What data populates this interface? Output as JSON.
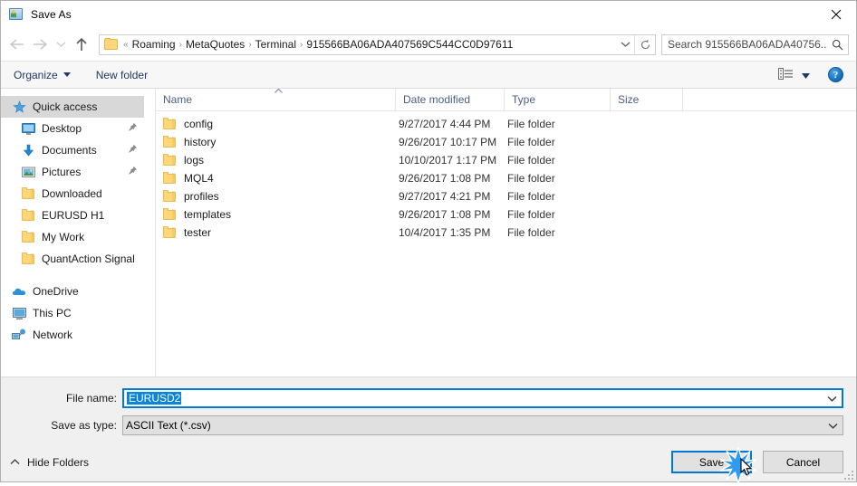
{
  "window": {
    "title": "Save As",
    "title_icon": "save-picture-icon",
    "close_icon": "close-icon"
  },
  "nav": {
    "back_icon": "arrow-left-icon",
    "forward_icon": "arrow-right-icon",
    "recent_icon": "chevron-down-icon",
    "up_icon": "arrow-up-icon",
    "address": {
      "folder_icon": "folder-icon",
      "prefix": "«",
      "crumbs": [
        "Roaming",
        "MetaQuotes",
        "Terminal",
        "915566BA06ADA407569C544CC0D97611"
      ],
      "separator": "›",
      "dropdown_icon": "chevron-down-icon",
      "refresh_icon": "refresh-icon"
    },
    "search": {
      "placeholder": "Search 915566BA06ADA40756...",
      "icon": "search-icon"
    }
  },
  "toolbar": {
    "organize_label": "Organize",
    "organize_caret_icon": "caret-down-icon",
    "new_folder_label": "New folder",
    "view_icon": "view-options-icon",
    "view_caret_icon": "caret-down-icon",
    "help_label": "?",
    "help_icon": "help-icon"
  },
  "sidebar": {
    "items": [
      {
        "label": "Quick access",
        "icon": "star-pin-icon",
        "selected": true,
        "pinned": false,
        "root": true
      },
      {
        "label": "Desktop",
        "icon": "desktop-icon",
        "selected": false,
        "pinned": true,
        "root": false
      },
      {
        "label": "Documents",
        "icon": "documents-download-icon",
        "selected": false,
        "pinned": true,
        "root": false
      },
      {
        "label": "Pictures",
        "icon": "pictures-icon",
        "selected": false,
        "pinned": true,
        "root": false
      },
      {
        "label": "Downloaded",
        "icon": "folder-icon",
        "selected": false,
        "pinned": false,
        "root": false
      },
      {
        "label": "EURUSD H1",
        "icon": "folder-icon",
        "selected": false,
        "pinned": false,
        "root": false
      },
      {
        "label": "My Work",
        "icon": "folder-icon",
        "selected": false,
        "pinned": false,
        "root": false
      },
      {
        "label": "QuantAction Signal",
        "icon": "folder-icon",
        "selected": false,
        "pinned": false,
        "root": false
      }
    ],
    "roots": [
      {
        "label": "OneDrive",
        "icon": "onedrive-cloud-icon"
      },
      {
        "label": "This PC",
        "icon": "this-pc-icon"
      },
      {
        "label": "Network",
        "icon": "network-icon"
      }
    ]
  },
  "filelist": {
    "columns": [
      "Name",
      "Date modified",
      "Type",
      "Size"
    ],
    "sort_column": "Name",
    "sort_icon": "sort-ascending-icon",
    "rows": [
      {
        "name": "config",
        "date": "9/27/2017 4:44 PM",
        "type": "File folder",
        "size": ""
      },
      {
        "name": "history",
        "date": "9/26/2017 10:17 PM",
        "type": "File folder",
        "size": ""
      },
      {
        "name": "logs",
        "date": "10/10/2017 1:17 PM",
        "type": "File folder",
        "size": ""
      },
      {
        "name": "MQL4",
        "date": "9/26/2017 1:08 PM",
        "type": "File folder",
        "size": ""
      },
      {
        "name": "profiles",
        "date": "9/27/2017 4:21 PM",
        "type": "File folder",
        "size": ""
      },
      {
        "name": "templates",
        "date": "9/26/2017 1:08 PM",
        "type": "File folder",
        "size": ""
      },
      {
        "name": "tester",
        "date": "10/4/2017 1:35 PM",
        "type": "File folder",
        "size": ""
      }
    ]
  },
  "form": {
    "filename_label": "File name:",
    "filename_value": "EURUSD2",
    "filename_dropdown_icon": "chevron-down-icon",
    "filetype_label": "Save as type:",
    "filetype_value": "ASCII Text (*.csv)",
    "filetype_dropdown_icon": "chevron-down-icon"
  },
  "footer": {
    "hide_folders_label": "Hide Folders",
    "hide_folders_icon": "chevron-up-icon",
    "save_label": "Save",
    "cancel_label": "Cancel",
    "resize_grip_icon": "resize-grip-icon"
  },
  "colors": {
    "accent": "#0078d7",
    "selection": "#0a84d8",
    "folder": "#ffd77a",
    "toolbar_text": "#1f3864"
  }
}
